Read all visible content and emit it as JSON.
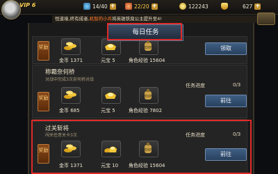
{
  "hud": {
    "vip": "VIP 6",
    "stamina": "14/40",
    "energy": "22/20",
    "gold": "122243",
    "ingot": "627"
  },
  "announcement": {
    "prefix": "恒道境,终有成者,",
    "highlight": "机智的小兵",
    "suffix": "将英雄铁扇公主提升至4!"
  },
  "title": "每日任务",
  "reward_badge": "奖励",
  "progress_prefix": "任务进度",
  "tasks": [
    {
      "rewards": {
        "gold": "金币 1371",
        "ingot": "元宝 5",
        "exp": "角色经验 15604"
      },
      "button": "领取"
    },
    {
      "title": "称霸奈何桥",
      "desc": "对战中完成3次奈何桥对战",
      "progress": "0/3",
      "rewards": {
        "gold": "金币 685",
        "ingot": "元宝 5",
        "exp": "角色经验 7802"
      },
      "button": "前往"
    },
    {
      "title": "过关斩将",
      "desc": "闯关任意关卡3次",
      "progress": "0/3",
      "rewards": {
        "gold": "金币 1371",
        "ingot": "元宝 10",
        "exp": "角色经验 15604"
      },
      "button": "前往"
    }
  ],
  "colors": {
    "highlight_border": "#e22a2a",
    "button_blue": "#3f5e82",
    "announce_name": "#ff7a2a"
  }
}
